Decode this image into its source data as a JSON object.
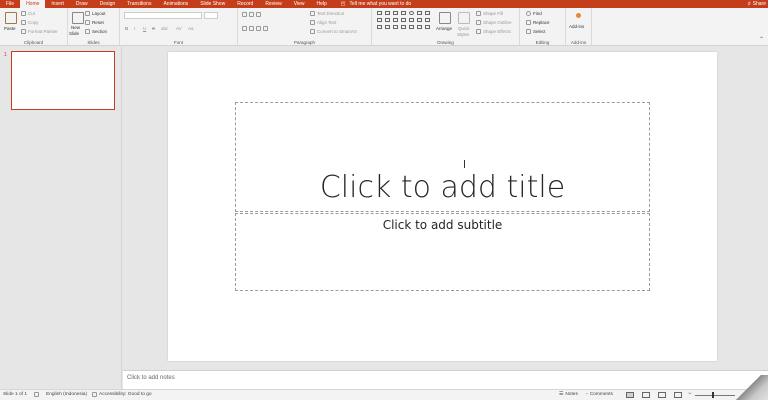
{
  "tabs": [
    "File",
    "Home",
    "Insert",
    "Draw",
    "Design",
    "Transitions",
    "Animations",
    "Slide Show",
    "Record",
    "Review",
    "View",
    "Help"
  ],
  "tell_me": "Tell me what you want to do",
  "share_label": "Share",
  "ribbon": {
    "clipboard": {
      "label": "Clipboard",
      "paste": "Paste",
      "cut": "Cut",
      "copy": "Copy",
      "format_painter": "Format Painter"
    },
    "slides": {
      "label": "Slides",
      "new_slide_1": "New",
      "new_slide_2": "Slide",
      "layout": "Layout",
      "reset": "Reset",
      "section": "Section"
    },
    "font": {
      "label": "Font",
      "bold": "B",
      "italic": "I",
      "underline": "U",
      "strike": "S",
      "shadow": "abc",
      "spacing": "AV",
      "case": "Aa"
    },
    "paragraph": {
      "label": "Paragraph",
      "text_direction": "Text Direction",
      "align_text": "Align Text",
      "smartart": "Convert to SmartArt"
    },
    "drawing": {
      "label": "Drawing",
      "arrange": "Arrange",
      "quick_styles_1": "Quick",
      "quick_styles_2": "Styles",
      "shape_fill": "Shape Fill",
      "shape_outline": "Shape Outline",
      "shape_effects": "Shape Effects"
    },
    "editing": {
      "label": "Editing",
      "find": "Find",
      "replace": "Replace",
      "select": "Select"
    },
    "addins": {
      "label": "Add-ins",
      "button": "Add-ins"
    }
  },
  "thumbnail_number": "1",
  "slide": {
    "title_placeholder": "Click to add title",
    "subtitle_placeholder": "Click to add subtitle"
  },
  "notes_placeholder": "Click to add notes",
  "status": {
    "slide_counter": "Slide 1 of 1",
    "language": "English (Indonesia)",
    "accessibility": "Accessibility: Good to go",
    "notes": "Notes",
    "comments": "Comments"
  },
  "colors": {
    "accent": "#c43e1c"
  }
}
